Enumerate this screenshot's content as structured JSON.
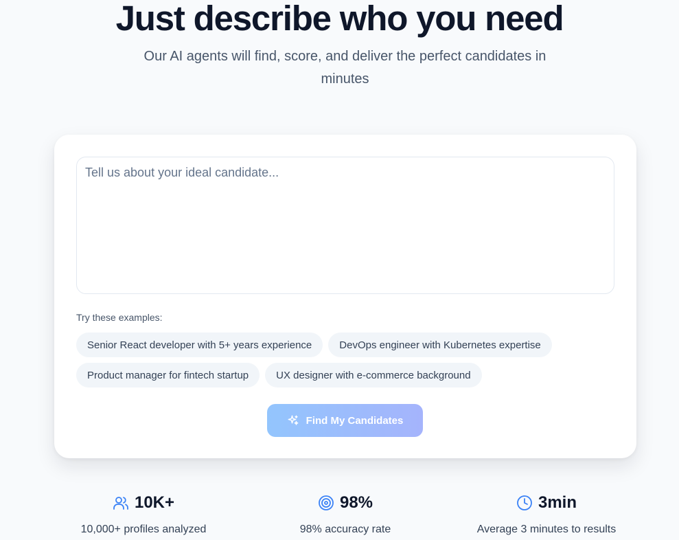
{
  "hero": {
    "title": "Just describe who you need",
    "subtitle": "Our AI agents will find, score, and deliver the perfect candidates in minutes"
  },
  "search": {
    "placeholder": "Tell us about your ideal candidate...",
    "value": "",
    "examples_label": "Try these examples:",
    "examples": [
      "Senior React developer with 5+ years experience",
      "DevOps engineer with Kubernetes expertise",
      "Product manager for fintech startup",
      "UX designer with e-commerce background"
    ],
    "submit_label": "Find My Candidates",
    "submit_icon": "sparkles-icon"
  },
  "stats": [
    {
      "icon": "users-icon",
      "value": "10K+",
      "description": "10,000+ profiles analyzed"
    },
    {
      "icon": "target-icon",
      "value": "98%",
      "description": "98% accuracy rate"
    },
    {
      "icon": "clock-icon",
      "value": "3min",
      "description": "Average 3 minutes to results"
    }
  ],
  "colors": {
    "accent": "#3b82f6",
    "button_start": "#93c5fd",
    "button_end": "#a5b4fc",
    "background": "#f8fafc"
  }
}
